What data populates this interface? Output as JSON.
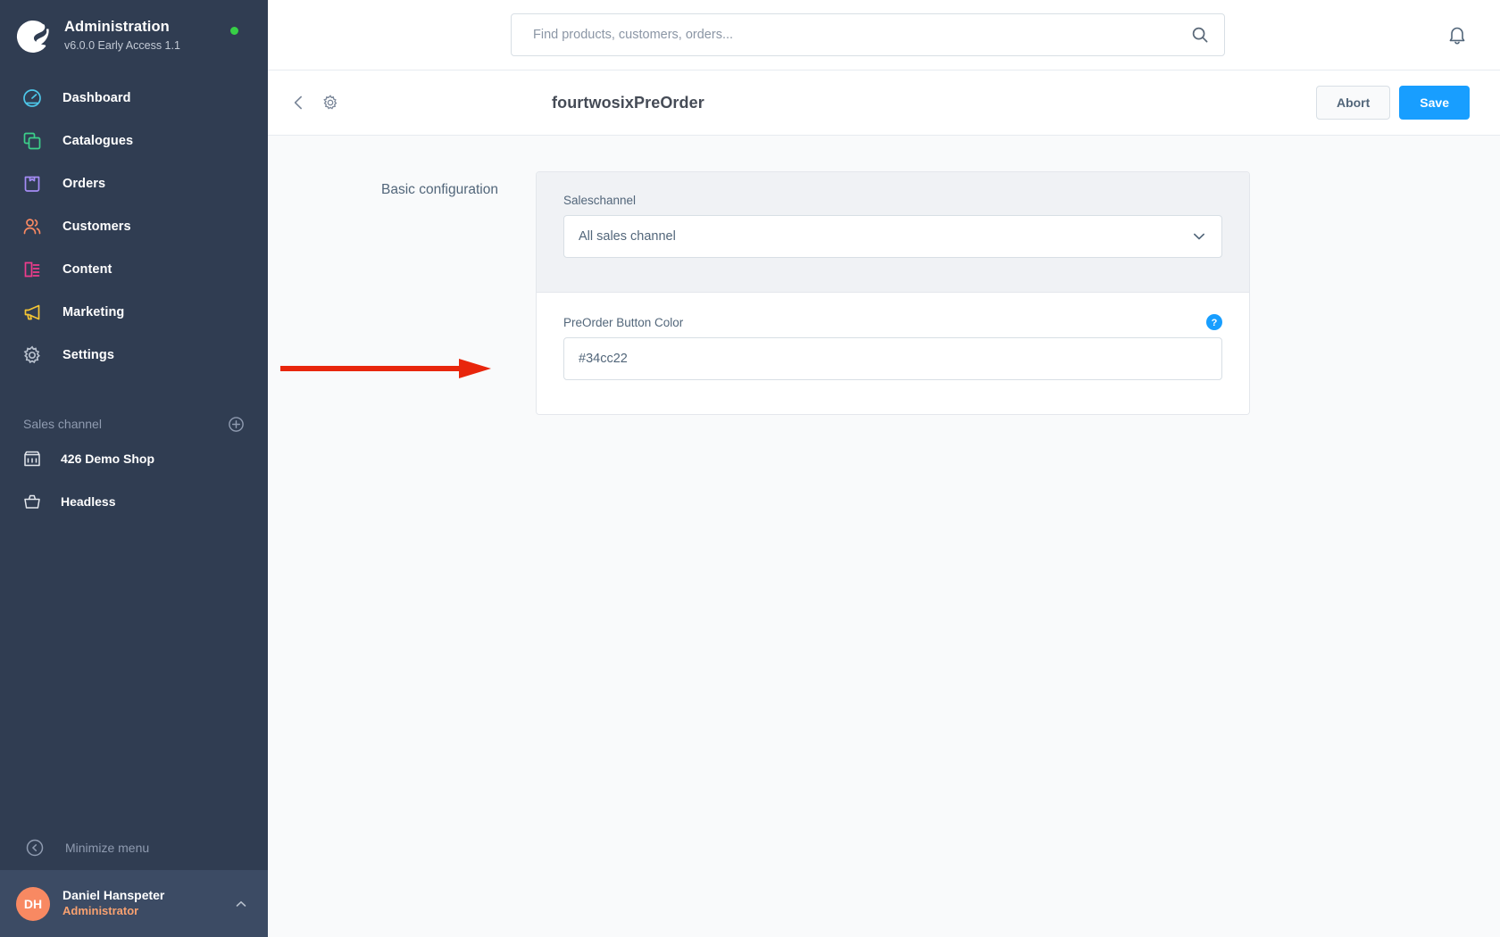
{
  "sidebar": {
    "brand": {
      "title": "Administration",
      "version": "v6.0.0 Early Access 1.1",
      "logo_icon": "shopware-logo-icon",
      "status_icon": "status-dot-online",
      "status_color": "#37d046"
    },
    "nav_items": [
      {
        "label": "Dashboard",
        "icon": "dashboard-icon",
        "color": "#4dc6e8"
      },
      {
        "label": "Catalogues",
        "icon": "catalogues-icon",
        "color": "#3cd08a"
      },
      {
        "label": "Orders",
        "icon": "orders-icon",
        "color": "#a48cf5"
      },
      {
        "label": "Customers",
        "icon": "customers-icon",
        "color": "#f88962"
      },
      {
        "label": "Content",
        "icon": "content-icon",
        "color": "#ee3c8c"
      },
      {
        "label": "Marketing",
        "icon": "marketing-icon",
        "color": "#f5c634"
      },
      {
        "label": "Settings",
        "icon": "gear-icon",
        "color": "#b6bfcc"
      }
    ],
    "sales_channel": {
      "heading": "Sales channel",
      "add_icon": "plus-circle-icon",
      "items": [
        {
          "label": "426 Demo Shop",
          "icon": "storefront-icon"
        },
        {
          "label": "Headless",
          "icon": "basket-icon"
        }
      ]
    },
    "minimize": {
      "label": "Minimize menu",
      "icon": "chevron-left-circle-icon"
    },
    "user": {
      "initials": "DH",
      "name": "Daniel Hanspeter",
      "role": "Administrator",
      "avatar_color": "#f88962",
      "role_color": "#f8a170",
      "caret_icon": "chevron-up-icon"
    }
  },
  "topbar": {
    "search": {
      "placeholder": "Find products, customers, orders...",
      "value": "",
      "icon": "search-icon"
    },
    "notifications_icon": "bell-icon"
  },
  "page_header": {
    "back_icon": "chevron-left-icon",
    "settings_icon": "gear-icon",
    "title": "fourtwosixPreOrder",
    "abort_label": "Abort",
    "save_label": "Save",
    "save_color": "#189eff"
  },
  "content": {
    "section_label": "Basic configuration",
    "saleschannel": {
      "label": "Saleschannel",
      "value": "All sales channel",
      "caret_icon": "chevron-down-icon"
    },
    "preorder_color": {
      "label": "PreOrder Button Color",
      "value": "#34cc22",
      "help_icon": "help-circle-icon",
      "help_color": "#189eff"
    },
    "annotation": {
      "icon": "red-arrow-right-annotation",
      "color": "#e8260c"
    }
  }
}
